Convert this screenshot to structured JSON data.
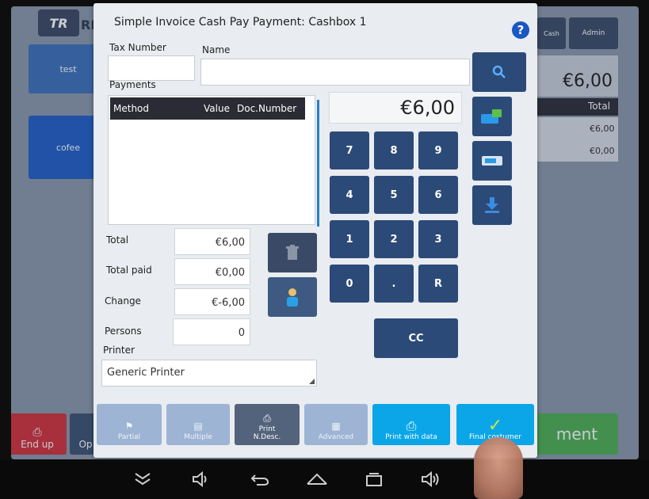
{
  "background": {
    "logo": "TR",
    "logo_suffix": "RE",
    "tile_test": "test",
    "tile_cofee": "cofee",
    "top_right_btn1": "Cash",
    "top_right_btn2": "Admin",
    "total_amount": "€6,00",
    "col_total": "Total",
    "row1_value": "€6,00",
    "row2_value": "€0,00",
    "end_up": "End up",
    "op_label": "Op",
    "payment_label": "ment"
  },
  "dialog": {
    "title": "Simple Invoice Cash Pay Payment: Cashbox 1",
    "help_icon": "?",
    "tax_number_label": "Tax Number",
    "name_label": "Name",
    "tax_number_value": "",
    "name_value": "",
    "payments_label": "Payments",
    "table_headers": [
      "Method",
      "Value",
      "Doc.Number"
    ],
    "total_label": "Total",
    "total_value": "€6,00",
    "total_paid_label": "Total paid",
    "total_paid_value": "€0,00",
    "change_label": "Change",
    "change_value": "€-6,00",
    "persons_label": "Persons",
    "persons_value": "0",
    "printer_label": "Printer",
    "printer_value": "Generic Printer",
    "amount_display": "€6,00",
    "keypad": [
      "7",
      "8",
      "9",
      "4",
      "5",
      "6",
      "1",
      "2",
      "3",
      "0",
      ".",
      "R"
    ],
    "cc_label": "CC",
    "bottom_buttons": {
      "partial": "Partial",
      "multiple": "Multiple",
      "print_ndesc_1": "Print",
      "print_ndesc_2": "N.Desc.",
      "advanced": "Advanced",
      "print_with_data": "Print with data",
      "final_costumer": "Final costumer"
    }
  },
  "icons": {
    "search": "search-icon",
    "card": "card-icon",
    "voucher": "voucher-icon",
    "download": "download-icon",
    "trash": "trash-icon",
    "person": "person-icon",
    "printer": "printer-icon",
    "check": "check-icon"
  },
  "colors": {
    "key_blue": "#2c4a78",
    "cyan": "#0aa6e8",
    "help_blue": "#1a56c4"
  }
}
